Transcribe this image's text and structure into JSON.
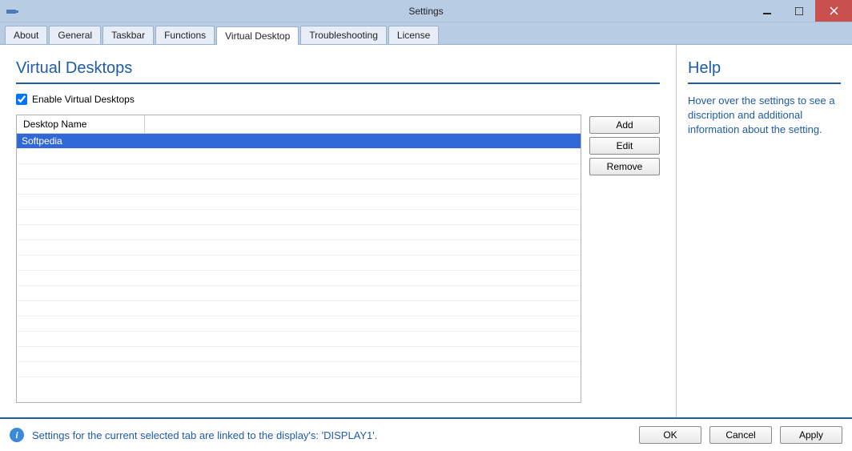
{
  "window": {
    "title": "Settings"
  },
  "tabs": [
    {
      "label": "About"
    },
    {
      "label": "General"
    },
    {
      "label": "Taskbar"
    },
    {
      "label": "Functions"
    },
    {
      "label": "Virtual Desktop",
      "active": true
    },
    {
      "label": "Troubleshooting"
    },
    {
      "label": "License"
    }
  ],
  "main": {
    "section_title": "Virtual Desktops",
    "enable_label": "Enable Virtual Desktops",
    "enable_checked": true,
    "table": {
      "column_header": "Desktop Name",
      "rows": [
        {
          "name": "Softpedia",
          "selected": true
        }
      ]
    },
    "buttons": {
      "add": "Add",
      "edit": "Edit",
      "remove": "Remove"
    }
  },
  "help": {
    "title": "Help",
    "text": "Hover over the settings to see a discription and additional information about the setting."
  },
  "footer": {
    "status": "Settings for the current selected  tab are linked to the display's: 'DISPLAY1'.",
    "ok": "OK",
    "cancel": "Cancel",
    "apply": "Apply"
  }
}
